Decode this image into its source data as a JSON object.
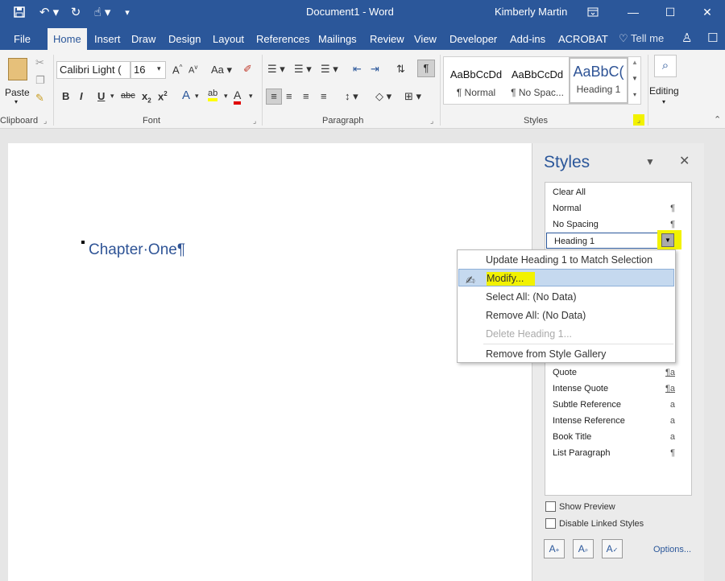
{
  "window": {
    "doc_title": "Document1  -  Word",
    "user": "Kimberly Martin"
  },
  "quick_access": {
    "save_icon": "save-icon",
    "undo_icon": "undo-icon",
    "redo_icon": "redo-icon",
    "touch_icon": "touch-mode-icon"
  },
  "tabs": [
    {
      "label": "File"
    },
    {
      "label": "Home"
    },
    {
      "label": "Insert"
    },
    {
      "label": "Draw"
    },
    {
      "label": "Design"
    },
    {
      "label": "Layout"
    },
    {
      "label": "References"
    },
    {
      "label": "Mailings"
    },
    {
      "label": "Review"
    },
    {
      "label": "View"
    },
    {
      "label": "Developer"
    },
    {
      "label": "Add-ins"
    },
    {
      "label": "ACROBAT"
    }
  ],
  "tell_me": "Tell me",
  "ribbon": {
    "clipboard": {
      "label": "Clipboard",
      "paste": "Paste"
    },
    "font": {
      "label": "Font",
      "family": "Calibri Light (",
      "size": "16",
      "change_case": "Aa"
    },
    "paragraph": {
      "label": "Paragraph"
    },
    "styles": {
      "label": "Styles",
      "items": [
        {
          "preview": "AaBbCcDd",
          "name": "¶ Normal"
        },
        {
          "preview": "AaBbCcDd",
          "name": "¶ No Spac..."
        },
        {
          "preview": "AaBbC(",
          "name": "Heading 1"
        }
      ]
    },
    "editing": {
      "label": "Editing"
    }
  },
  "document": {
    "heading": "Chapter·One¶"
  },
  "styles_pane": {
    "title": "Styles",
    "items": [
      {
        "name": "Clear All",
        "glyph": ""
      },
      {
        "name": "Normal",
        "glyph": "¶"
      },
      {
        "name": "No Spacing",
        "glyph": "¶"
      },
      {
        "name": "Heading 1",
        "glyph": ""
      },
      {
        "name": "Quote",
        "glyph": "¶a"
      },
      {
        "name": "Intense Quote",
        "glyph": "¶a"
      },
      {
        "name": "Subtle Reference",
        "glyph": "a"
      },
      {
        "name": "Intense Reference",
        "glyph": "a"
      },
      {
        "name": "Book Title",
        "glyph": "a"
      },
      {
        "name": "List Paragraph",
        "glyph": "¶"
      }
    ],
    "show_preview": "Show Preview",
    "disable_linked": "Disable Linked Styles",
    "options": "Options..."
  },
  "context_menu": {
    "items": [
      {
        "label": "Update Heading 1 to Match Selection"
      },
      {
        "label": "Modify..."
      },
      {
        "label": "Select All: (No Data)"
      },
      {
        "label": "Remove All: (No Data)"
      },
      {
        "label": "Delete Heading 1..."
      },
      {
        "label": "Remove from Style Gallery"
      }
    ]
  },
  "colors": {
    "accent": "#2b579a",
    "highlight": "#f2f200",
    "heading": "#2f5496"
  }
}
